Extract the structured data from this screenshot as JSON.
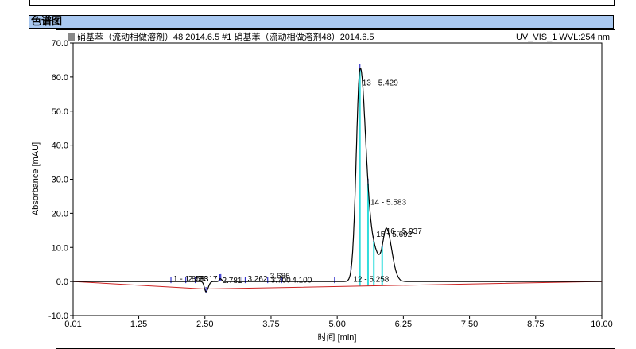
{
  "section": {
    "title": "色谱图"
  },
  "chart_data": {
    "type": "line",
    "title_left": "硝基苯（流动相做溶剂）48 2014.6.5 #1  硝基苯（流动相做溶剂48）2014.6.5",
    "title_right": "UV_VIS_1 WVL:254 nm",
    "xlabel": "时间 [min]",
    "ylabel": "Absorbance [mAU]",
    "xlim": [
      0.01,
      10.0
    ],
    "ylim": [
      -10.0,
      70.0
    ],
    "x_ticks": [
      "0.01",
      "1.25",
      "2.50",
      "3.75",
      "5.00",
      "6.25",
      "7.50",
      "8.75",
      "10.00"
    ],
    "x_tick_values": [
      0.01,
      1.25,
      2.5,
      3.75,
      5.0,
      6.25,
      7.5,
      8.75,
      10.0
    ],
    "y_ticks": [
      "-10.0",
      "0.0",
      "10.0",
      "20.0",
      "30.0",
      "40.0",
      "50.0",
      "60.0",
      "70.0"
    ],
    "y_tick_values": [
      -10,
      0,
      10,
      20,
      30,
      40,
      50,
      60,
      70
    ],
    "peaks": [
      {
        "time": 5.429,
        "height": 58.0,
        "width": 0.07
      },
      {
        "time": 5.6,
        "height": 12.0,
        "width": 0.12
      },
      {
        "time": 5.937,
        "height": 14.0,
        "width": 0.07
      },
      {
        "time": 2.52,
        "height": -3.0,
        "width": 0.03
      },
      {
        "time": 2.79,
        "height": 0.8,
        "width": 0.02
      }
    ],
    "baseline": {
      "x": [
        0.01,
        2.5,
        10.0
      ],
      "y": [
        0,
        -2.2,
        0
      ]
    },
    "peak_labels": [
      {
        "text": "1 - 1.858",
        "time": 1.858,
        "y": 1.0
      },
      {
        "text": "2.138",
        "time": 2.138,
        "y": 1.0
      },
      {
        "text": "2.317",
        "time": 2.317,
        "y": 1.0
      },
      {
        "text": "2.781",
        "time": 2.781,
        "y": 0.5
      },
      {
        "text": "3.262",
        "time": 3.262,
        "y": 1.0
      },
      {
        "text": "3.686",
        "time": 3.686,
        "y": 1.8
      },
      {
        "text": "3.700",
        "time": 3.7,
        "y": 0.6
      },
      {
        "text": "4.100",
        "time": 4.1,
        "y": 0.6
      },
      {
        "text": "12 - 5.258",
        "time": 5.258,
        "y": 0.8
      },
      {
        "text": "13 - 5.429",
        "time": 5.429,
        "y": 58.5
      },
      {
        "text": "14 - 5.583",
        "time": 5.583,
        "y": 23.5
      },
      {
        "text": "15 - 5.692",
        "time": 5.692,
        "y": 14.0
      },
      {
        "text": "16 - 5.937",
        "time": 5.88,
        "y": 15.0
      }
    ],
    "marker_times": [
      1.858,
      2.138,
      2.317,
      2.52,
      2.781,
      2.8,
      3.2,
      3.262,
      3.686,
      3.95,
      4.95,
      5.258,
      5.429,
      5.583,
      5.692,
      5.85
    ],
    "colors": {
      "trace": "#000000",
      "baseline": "#cc2222",
      "marker": "#3333cc",
      "fill": "#33dddd"
    }
  }
}
